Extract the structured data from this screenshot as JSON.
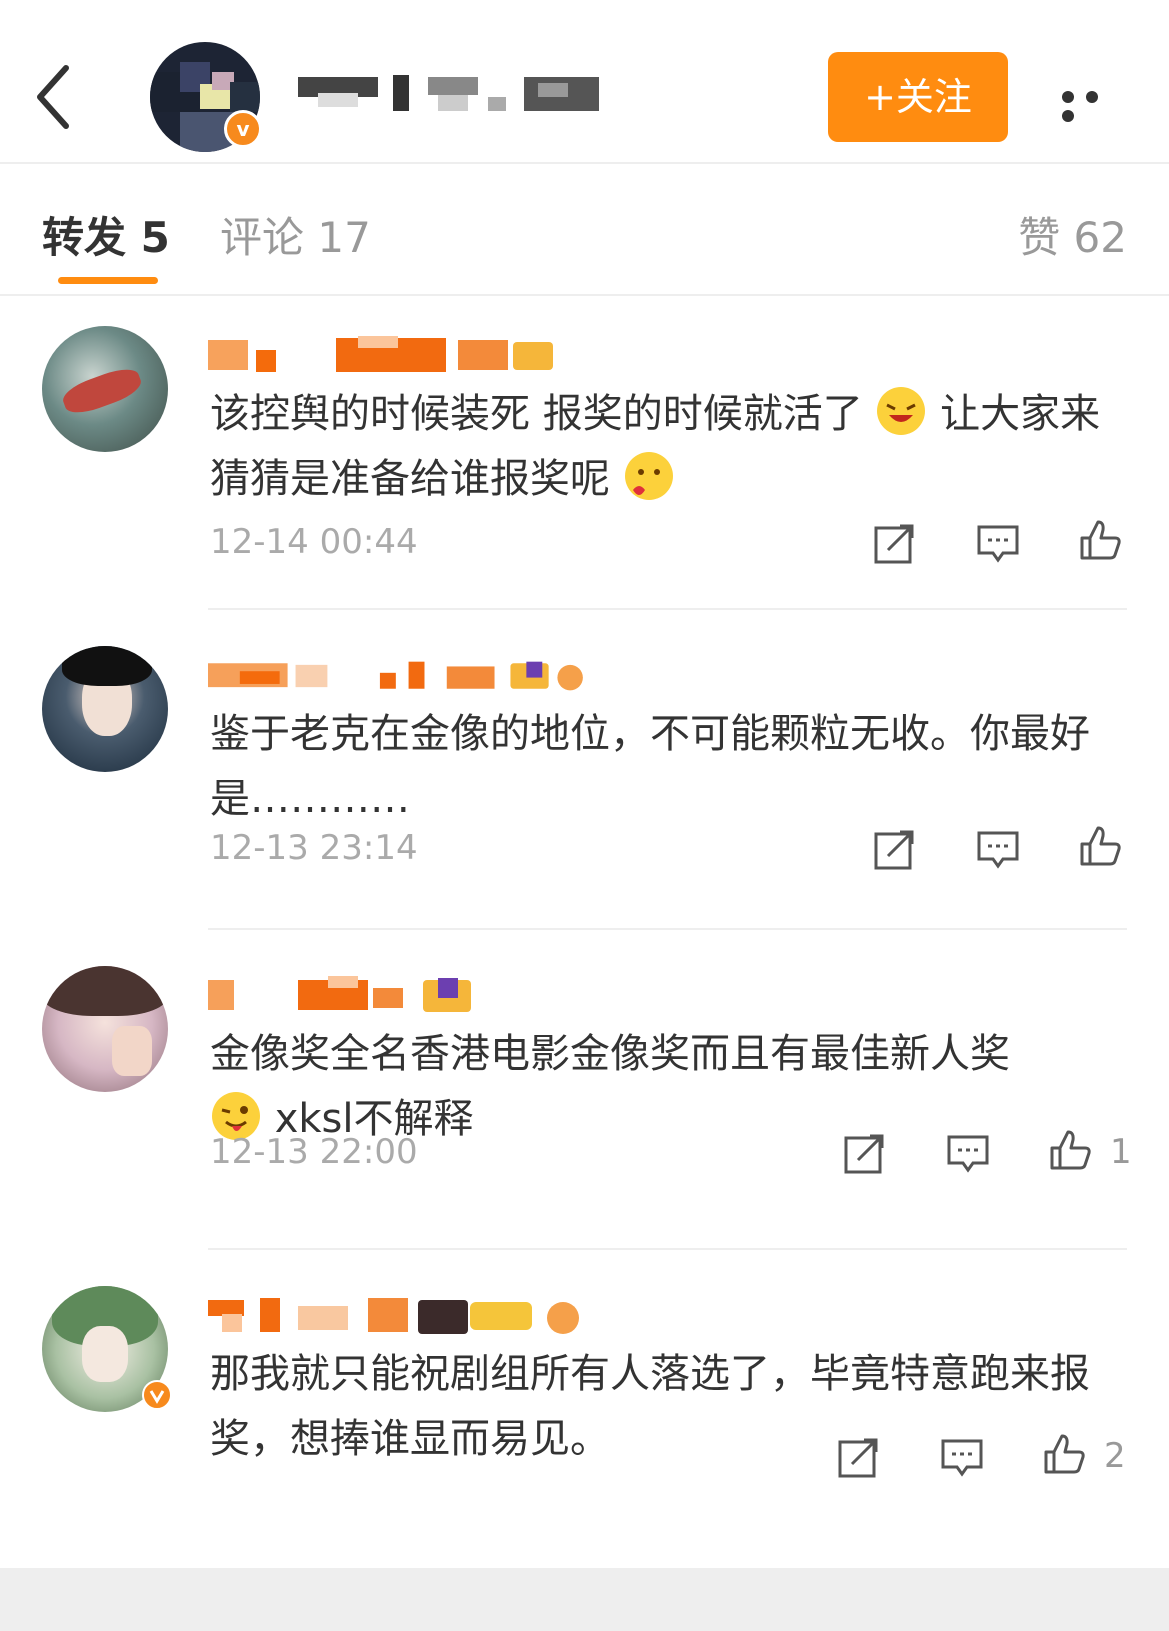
{
  "header": {
    "follow_label": "+关注"
  },
  "tabs": {
    "repost": "转发 5",
    "comment": "评论 17",
    "like": "赞 62"
  },
  "comments": [
    {
      "text": "该控舆的时候装死 报奖的时候就活了",
      "text2": "让大家来猜猜是准备给谁报奖呢",
      "time": "12-14 00:44",
      "likes": ""
    },
    {
      "text": "鉴于老克在金像的地位，不可能颗粒无收。你最好是…………",
      "time": "12-13 23:14",
      "likes": ""
    },
    {
      "text": "金像奖全名香港电影金像奖而且有最佳新人奖",
      "text2": "xksl不解释",
      "time": "12-13 22:00",
      "likes": "1"
    },
    {
      "text": "那我就只能祝剧组所有人落选了，毕竟特意跑来报奖，想捧谁显而易见。",
      "time": "",
      "likes": "2"
    }
  ],
  "icons": {
    "back": "chevron-left-icon",
    "more": "more-dots-icon",
    "share": "share-icon",
    "reply": "comment-icon",
    "like": "thumbs-up-icon"
  },
  "colors": {
    "accent": "#ff8c10",
    "verified": "#f78a1d"
  }
}
